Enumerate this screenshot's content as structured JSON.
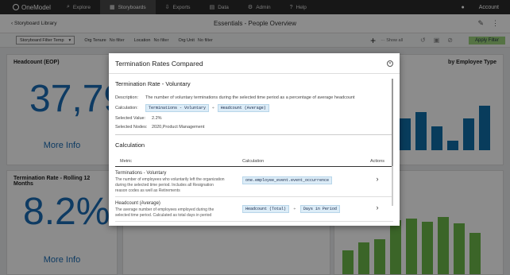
{
  "app": {
    "logo": "OneModel"
  },
  "nav": {
    "items": [
      "Explore",
      "Storyboards",
      "Exports",
      "Data",
      "Admin",
      "Help"
    ],
    "active": "Storyboards"
  },
  "topright": {
    "account": "Account"
  },
  "header": {
    "back": "Storyboard Library",
    "title": "Essentials - People Overview"
  },
  "filters": {
    "storyboard_filter": "Storyboard Filter Temp",
    "org_tenure_label": "Org Tenure",
    "org_tenure_value": "No filter",
    "location_label": "Location",
    "location_value": "No filter",
    "org_unit_label": "Org Unit",
    "org_unit_value": "No filter",
    "show_all": "Show all",
    "apply": "Apply Filter"
  },
  "cards": {
    "headcount_title": "Headcount (EOP)",
    "headcount_value": "37,79",
    "more_info": "More Info",
    "term_title": "Termination Rate - Rolling 12 Months",
    "term_value": "8.2%",
    "right_title": "by Employee Type"
  },
  "modal": {
    "title": "Termination Rates Compared",
    "section1": "Termination Rate - Voluntary",
    "description_label": "Description:",
    "description": "The number of voluntary terminations during the selected time period as a percentage of average headcount",
    "calculation_label": "Calculation:",
    "calc_chip1": "Terminations - Voluntary",
    "calc_op": "÷",
    "calc_chip2": "Headcount (Average)",
    "selected_value_label": "Selected Value:",
    "selected_value": "2.2%",
    "selected_nodes_label": "Selected Nodes:",
    "selected_nodes": "2020,Product Management",
    "section2": "Calculation",
    "col_metric": "Metric",
    "col_calc": "Calculation",
    "col_actions": "Actions",
    "rows": [
      {
        "name": "Terminations - Voluntary",
        "desc": "The number of employees who voluntarily left the organization during the selected time period. Includes all Resignation reason codes as well as Retirements",
        "chip1": "one.employee_event.event_occurrence",
        "op": "",
        "chip2": ""
      },
      {
        "name": "Headcount (Average)",
        "desc": "The average number of employees employed during the selected time period. Calculated as total days in period",
        "chip1": "Headcount (Total)",
        "op": "÷",
        "chip2": "Days in Period"
      }
    ]
  }
}
